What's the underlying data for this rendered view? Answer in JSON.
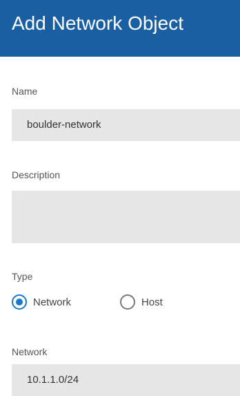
{
  "dialog": {
    "title": "Add Network Object"
  },
  "name": {
    "label": "Name",
    "value": "boulder-network"
  },
  "description": {
    "label": "Description",
    "value": ""
  },
  "type": {
    "label": "Type",
    "options": [
      {
        "label": "Network",
        "selected": true
      },
      {
        "label": "Host",
        "selected": false
      }
    ]
  },
  "network": {
    "label": "Network",
    "value": "10.1.1.0/24"
  },
  "colors": {
    "header": "#1b5fa3",
    "radio_accent": "#1b78c9",
    "field_bg": "#e6e6e6"
  }
}
